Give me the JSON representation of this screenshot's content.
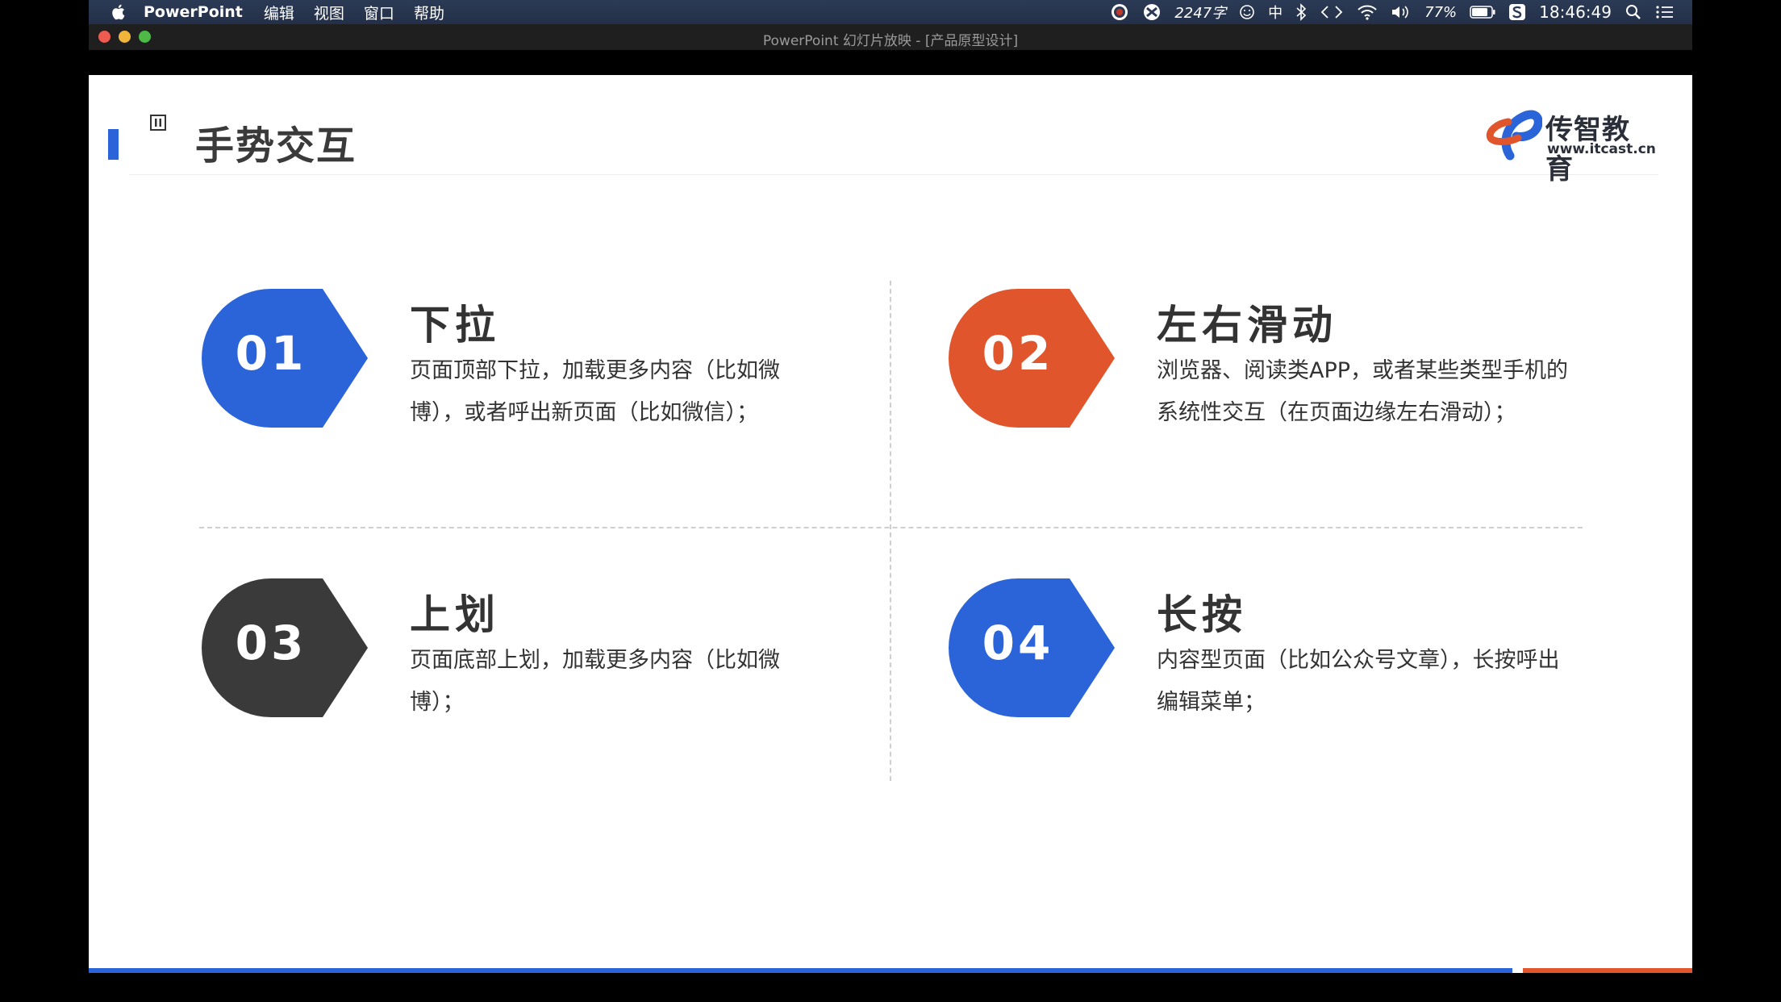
{
  "menubar": {
    "app_name": "PowerPoint",
    "menus": [
      "编辑",
      "视图",
      "窗口",
      "帮助"
    ],
    "word_count": "2247字",
    "input_method": "中",
    "battery": "77%",
    "time": "18:46:49"
  },
  "window": {
    "title": "PowerPoint 幻灯片放映 - [产品原型设计]"
  },
  "slide": {
    "title": "手势交互",
    "logo": {
      "brand": "传智教育",
      "url": "www.itcast.cn"
    },
    "items": [
      {
        "num": "01",
        "title": "下拉",
        "desc": "页面顶部下拉，加载更多内容（比如微博），或者呼出新页面（比如微信）；",
        "color": "#2b64d8"
      },
      {
        "num": "02",
        "title": "左右滑动",
        "desc": "浏览器、阅读类APP，或者某些类型手机的系统性交互（在页面边缘左右滑动）；",
        "color": "#e1552c"
      },
      {
        "num": "03",
        "title": "上划",
        "desc": "页面底部上划，加载更多内容（比如微博）；",
        "color": "#3a3a3a"
      },
      {
        "num": "04",
        "title": "长按",
        "desc": "内容型页面（比如公众号文章），长按呼出编辑菜单；",
        "color": "#2b64d8"
      }
    ],
    "bottom_bar_colors": {
      "blue": "#2b64d8",
      "red": "#e1552c"
    }
  }
}
